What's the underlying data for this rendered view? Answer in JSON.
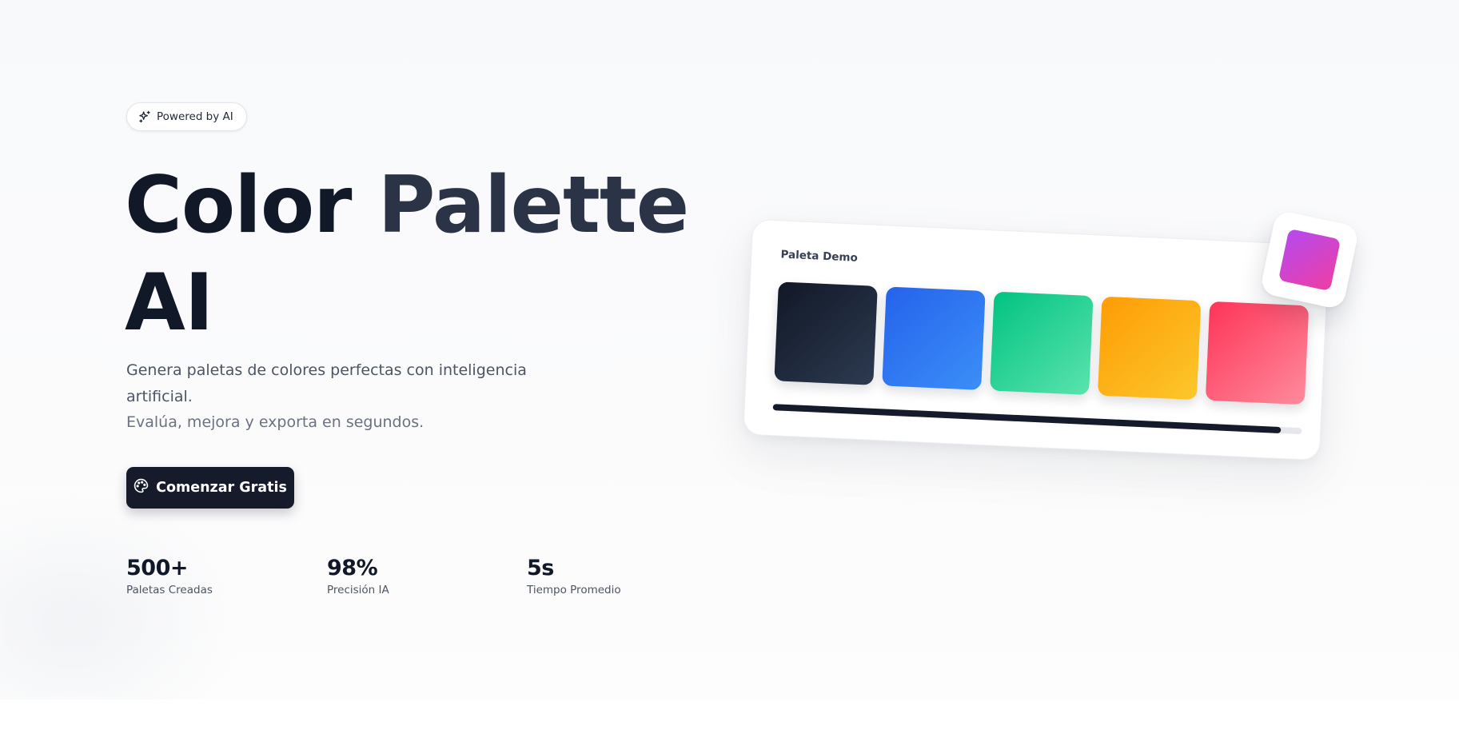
{
  "badge": {
    "icon": "sparkles-icon",
    "label": "Powered by AI"
  },
  "hero": {
    "title_line1_word1": "Color",
    "title_line1_word2": "Palette",
    "title_line2": "AI",
    "subtitle_line1": "Genera paletas de colores perfectas con inteligencia artificial.",
    "subtitle_line2": "Evalúa, mejora y exporta en segundos.",
    "cta": {
      "icon": "palette-icon",
      "label": "Comenzar Gratis"
    }
  },
  "stats": [
    {
      "value": "500+",
      "label": "Paletas Creadas"
    },
    {
      "value": "98%",
      "label": "Precisión IA"
    },
    {
      "value": "5s",
      "label": "Tiempo Promedio"
    }
  ],
  "demo_card": {
    "title": "Paleta Demo",
    "swatches": [
      {
        "from": "#111827",
        "to": "#2d3a50"
      },
      {
        "from": "#2563eb",
        "to": "#3b8ef8"
      },
      {
        "from": "#02c382",
        "to": "#5ae3ad"
      },
      {
        "from": "#ff9c05",
        "to": "#fbc72b"
      },
      {
        "from": "#fe3458",
        "to": "#fe8b9c"
      }
    ],
    "progress": 0.96,
    "floating_swatch": {
      "from": "#b54af0",
      "to": "#ee3ea4"
    }
  },
  "colors": {
    "primary": "#151b2b",
    "text": "#111827",
    "muted": "#4b5563"
  }
}
